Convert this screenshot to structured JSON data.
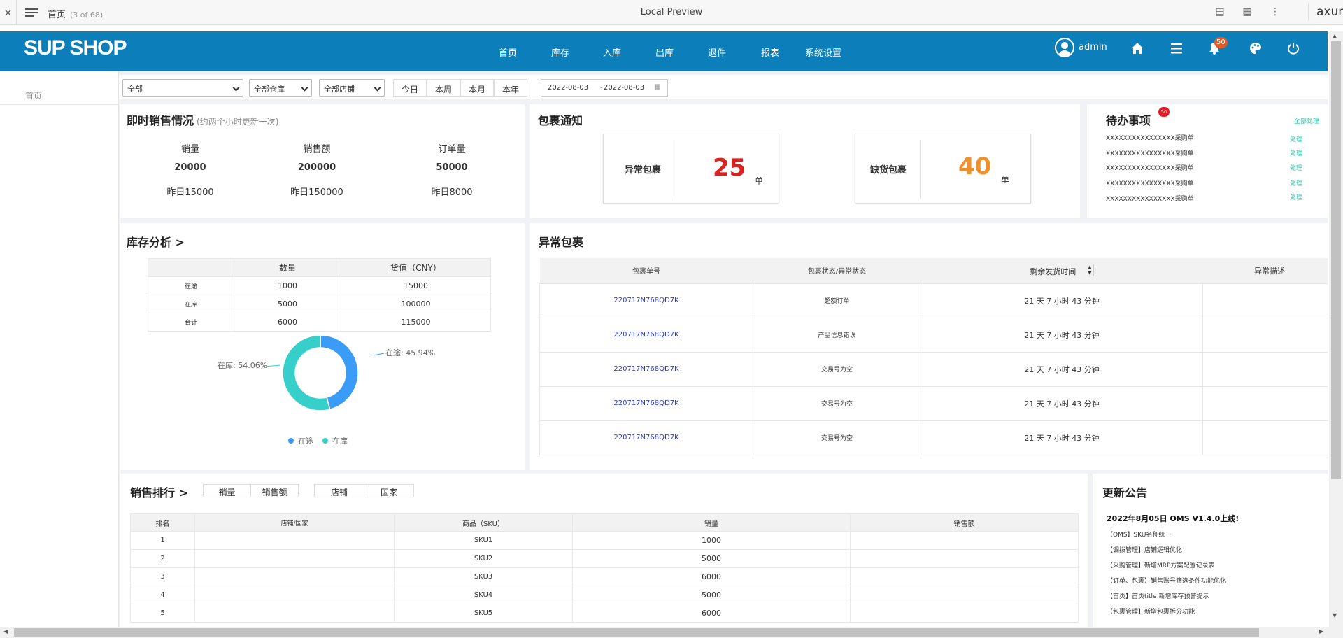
{
  "axure_bar": {
    "close": "×",
    "page_title": "首页",
    "page_count": "(3 of 68)",
    "center_title": "Local Preview",
    "logo": "axure"
  },
  "header": {
    "brand": "SUP SHOP",
    "nav": [
      "首页",
      "库存",
      "入库",
      "出库",
      "退件",
      "报表",
      "系统设置"
    ],
    "user": "admin",
    "notification_count": "50"
  },
  "sidebar": {
    "breadcrumb": "首页"
  },
  "filter": {
    "selects": [
      "全部",
      "全部仓库",
      "全部店铺"
    ],
    "quick": [
      "今日",
      "本周",
      "本月",
      "本年"
    ],
    "date_start": "2022-08-03",
    "date_sep": "-",
    "date_end": "2022-08-03"
  },
  "realtime": {
    "title": "即时销售情况",
    "subtitle": "(约两个小时更新一次)",
    "metrics": [
      {
        "label": "销量",
        "value": "20000",
        "yesterday": "昨日15000"
      },
      {
        "label": "销售额",
        "value": "200000",
        "yesterday": "昨日150000"
      },
      {
        "label": "订单量",
        "value": "50000",
        "yesterday": "昨日8000"
      }
    ]
  },
  "parcel_notice": {
    "title": "包裹通知",
    "abnormal": {
      "label": "异常包裹",
      "count": "25",
      "unit": "单"
    },
    "shortage": {
      "label": "缺货包裹",
      "count": "40",
      "unit": "单"
    }
  },
  "todo": {
    "title": "待办事项",
    "badge": "50",
    "handle_all": "全部处理",
    "items": [
      {
        "text": "XXXXXXXXXXXXXXXX采购单",
        "action": "处理"
      },
      {
        "text": "XXXXXXXXXXXXXXXX采购单",
        "action": "处理"
      },
      {
        "text": "XXXXXXXXXXXXXXXX采购单",
        "action": "处理"
      },
      {
        "text": "XXXXXXXXXXXXXXXX采购单",
        "action": "处理"
      },
      {
        "text": "XXXXXXXXXXXXXXXX采购单",
        "action": "处理"
      }
    ]
  },
  "inventory": {
    "title": "库存分析 >",
    "columns": [
      "",
      "数量",
      "货值（CNY）"
    ],
    "rows": [
      [
        "在途",
        "1000",
        "15000"
      ],
      [
        "在库",
        "5000",
        "100000"
      ],
      [
        "合计",
        "6000",
        "115000"
      ]
    ],
    "donut_labels": {
      "transit": "在途: 45.94%",
      "stock": "在库: 54.06%"
    },
    "legend": [
      "在途",
      "在库"
    ],
    "colors": {
      "transit": "#3a9cf6",
      "stock": "#36cfc9"
    }
  },
  "chart_data": {
    "type": "pie",
    "categories": [
      "在途",
      "在库"
    ],
    "values": [
      45.94,
      54.06
    ],
    "title": "",
    "legend": "bottom"
  },
  "abnormal_parcels": {
    "title": "异常包裹",
    "columns": [
      "包裹单号",
      "包裹状态/异常状态",
      "剩余发货时间",
      "异常描述"
    ],
    "rows": [
      [
        "220717N768QD7K",
        "超额订单",
        "21 天 7 小时 43 分钟",
        ""
      ],
      [
        "220717N768QD7K",
        "产品信息错误",
        "21 天 7 小时 43 分钟",
        ""
      ],
      [
        "220717N768QD7K",
        "交易号为空",
        "21 天 7 小时 43 分钟",
        ""
      ],
      [
        "220717N768QD7K",
        "交易号为空",
        "21 天 7 小时 43 分钟",
        ""
      ],
      [
        "220717N768QD7K",
        "交易号为空",
        "21 天 7 小时 43 分钟",
        ""
      ]
    ]
  },
  "ranking": {
    "title": "销售排行 >",
    "tabs1": [
      "销量",
      "销售额"
    ],
    "tabs2": [
      "店铺",
      "国家"
    ],
    "columns": [
      "排名",
      "店铺/国家",
      "商品（SKU）",
      "销量",
      "销售额"
    ],
    "rows": [
      [
        "1",
        "",
        "SKU1",
        "1000",
        ""
      ],
      [
        "2",
        "",
        "SKU2",
        "5000",
        ""
      ],
      [
        "3",
        "",
        "SKU3",
        "6000",
        ""
      ],
      [
        "4",
        "",
        "SKU4",
        "5000",
        ""
      ],
      [
        "5",
        "",
        "SKU5",
        "6000",
        ""
      ]
    ]
  },
  "updates": {
    "title": "更新公告",
    "headline": "2022年8月05日 OMS V1.4.0上线!",
    "items": [
      "【OMS】SKU名称统一",
      "【调拨管理】店铺逻辑优化",
      "【采购管理】新增MRP方案配置记录表",
      "【订单、包裹】销售账号筛选条件功能优化",
      "【首页】首页title 新增库存预警提示",
      "【包裹管理】新增包裹拆分功能"
    ]
  }
}
